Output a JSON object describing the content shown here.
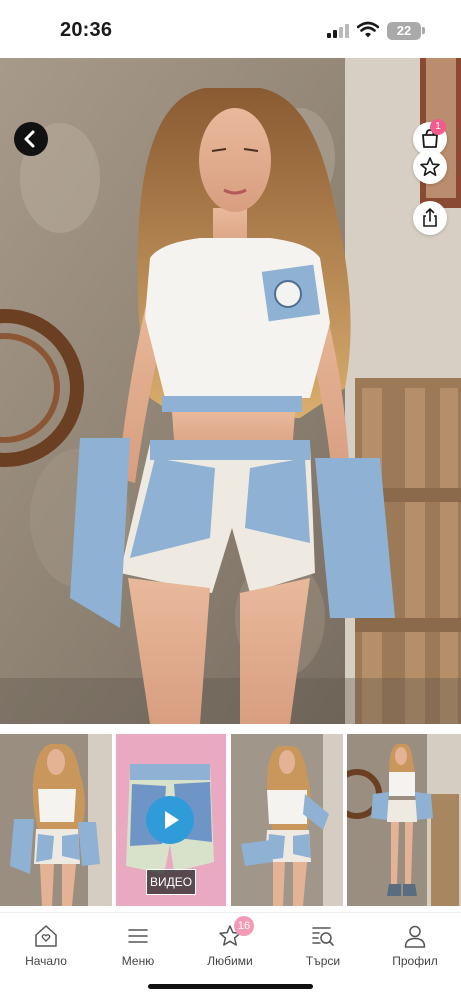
{
  "status_bar": {
    "time": "20:36",
    "battery": "22",
    "icons": [
      "cellular-signal-icon",
      "wifi-icon",
      "battery-icon"
    ]
  },
  "hero": {
    "image_description_icon": "product-photo",
    "buttons": [
      "back-icon",
      "cart-icon",
      "star-icon",
      "share-icon",
      "expand-icon"
    ],
    "cart_count": "1"
  },
  "thumbnails": {
    "video_label": "ВИДЕО",
    "items": [
      "photo",
      "video",
      "photo",
      "photo"
    ]
  },
  "tab_bar": {
    "items": [
      {
        "label": "Начало",
        "icon": "home-heart-icon"
      },
      {
        "label": "Меню",
        "icon": "menu-icon"
      },
      {
        "label": "Любими",
        "icon": "star-icon"
      },
      {
        "label": "Търси",
        "icon": "search-list-icon"
      },
      {
        "label": "Профил",
        "icon": "profile-icon"
      }
    ],
    "favorites_count": "16"
  },
  "colors": {
    "accent_pink": "#f25c8c",
    "badge_pink": "#f49ab7",
    "play_blue": "#2f9bd8",
    "denim": "#8fb1d4"
  }
}
